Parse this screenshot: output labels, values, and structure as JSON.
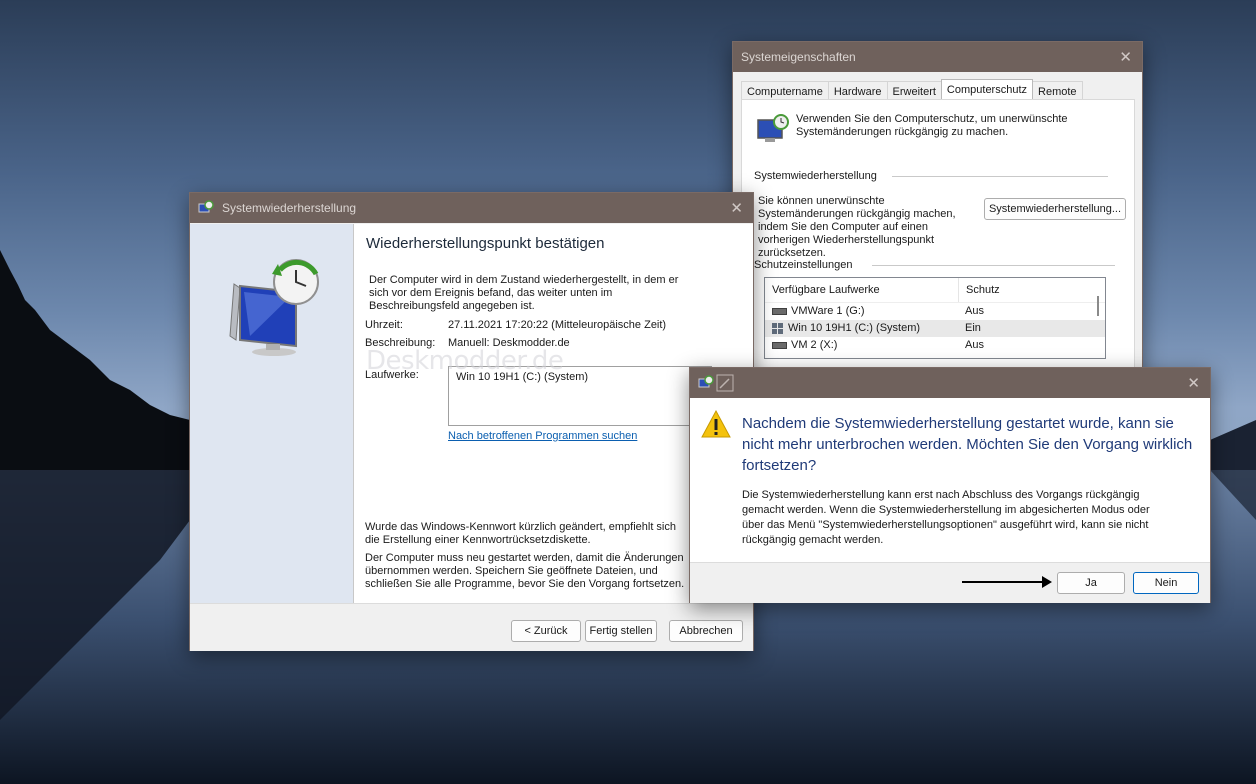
{
  "sysprops": {
    "title": "Systemeigenschaften",
    "tabs": [
      "Computername",
      "Hardware",
      "Erweitert",
      "Computerschutz",
      "Remote"
    ],
    "active_tab": "Computerschutz",
    "intro": "Verwenden Sie den Computerschutz, um unerwünschte Systemänderungen rückgängig zu machen.",
    "section_restore": "Systemwiederherstellung",
    "restore_desc": "Sie können unerwünschte Systemänderungen rückgängig machen, indem Sie den Computer auf einen vorherigen Wiederherstellungspunkt zurücksetzen.",
    "restore_button": "Systemwiederherstellung...",
    "section_protection": "Schutzeinstellungen",
    "list_headers": [
      "Verfügbare Laufwerke",
      "Schutz"
    ],
    "drives": [
      {
        "name": "VMWare 1 (G:)",
        "status": "Aus",
        "icon": "drive-icon"
      },
      {
        "name": "Win 10 19H1 (C:) (System)",
        "status": "Ein",
        "icon": "windows-drive-icon"
      },
      {
        "name": "VM 2 (X:)",
        "status": "Aus",
        "icon": "drive-icon"
      }
    ]
  },
  "restore": {
    "title": "Systemwiederherstellung",
    "heading": "Wiederherstellungspunkt bestätigen",
    "intro": "Der Computer wird in dem Zustand wiederhergestellt, in dem er sich vor dem Ereignis befand, das weiter unten im Beschreibungsfeld angegeben ist.",
    "time_label": "Uhrzeit:",
    "time_value": "27.11.2021 17:20:22 (Mitteleuropäische Zeit)",
    "desc_label": "Beschreibung:",
    "desc_value": "Manuell: Deskmodder.de",
    "drives_label": "Laufwerke:",
    "drives_value": "Win 10 19H1 (C:) (System)",
    "link": "Nach betroffenen Programmen suchen",
    "note1": "Wurde das Windows-Kennwort kürzlich geändert, empfiehlt sich die Erstellung einer Kennwortrücksetzdiskette.",
    "note2": "Der Computer muss neu gestartet werden, damit die Änderungen übernommen werden. Speichern Sie geöffnete Dateien, und schließen Sie alle Programme, bevor Sie den Vorgang fortsetzen.",
    "back_button": "< Zurück",
    "finish_button": "Fertig stellen",
    "cancel_button": "Abbrechen",
    "watermark": "Deskmodder.de"
  },
  "confirm": {
    "title": "Nachdem die Systemwiederherstellung gestartet wurde, kann sie nicht mehr unterbrochen werden. Möchten Sie den Vorgang wirklich fortsetzen?",
    "body": "Die Systemwiederherstellung kann erst nach Abschluss des Vorgangs rückgängig gemacht werden. Wenn die Systemwiederherstellung im abgesicherten Modus oder über das Menü \"Systemwiederherstellungsoptionen\" ausgeführt wird, kann sie nicht rückgängig gemacht werden.",
    "yes_button": "Ja",
    "no_button": "Nein"
  },
  "colors": {
    "titlebar": "#6f615c",
    "link": "#0b5fb0",
    "accent": "#1f3a78"
  }
}
